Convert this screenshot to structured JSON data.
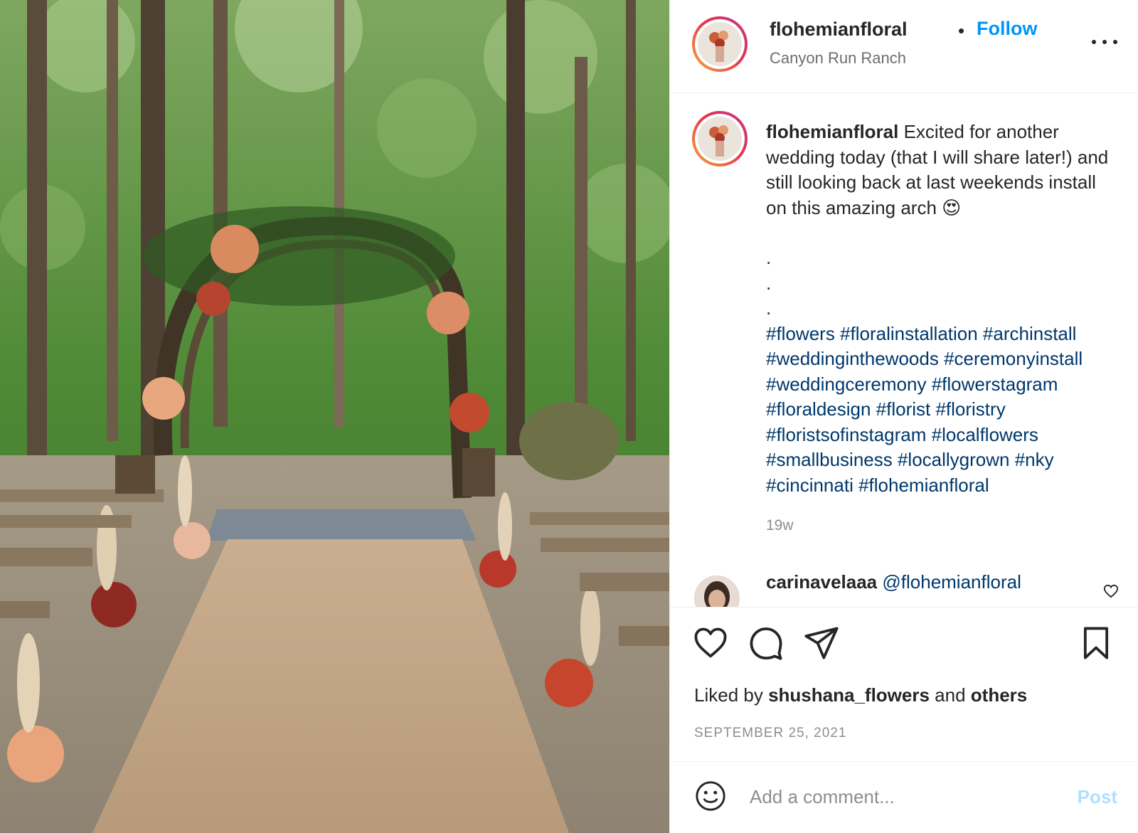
{
  "post": {
    "image_alt": "Woodland wedding ceremony with floral arch and burlap aisle",
    "header": {
      "username": "flohemianfloral",
      "separator": "•",
      "follow_label": "Follow",
      "location": "Canyon Run Ranch",
      "more_icon": "more-horizontal-icon"
    },
    "caption": {
      "username": "flohemianfloral",
      "text": "Excited for another wedding today (that I will share later!) and still looking back at last weekends install on this amazing arch",
      "emoji": "😍",
      "bullets": [
        ".",
        ".",
        "."
      ],
      "hashtags": "#flowers #floralinstallation #archinstall #weddinginthewoods #ceremonyinstall #weddingceremony #flowerstagram #floraldesign #florist #floristry #floristsofinstagram #localflowers #smallbusiness #locallygrown #nky #cincinnati #flohemianfloral",
      "age": "19w"
    },
    "comment": {
      "username": "carinavelaaa",
      "text": "@flohemianfloral"
    },
    "actions": {
      "like_icon": "heart-icon",
      "comment_icon": "comment-icon",
      "share_icon": "share-icon",
      "save_icon": "bookmark-icon"
    },
    "likes": {
      "prefix": "Liked by",
      "user": "shushana_flowers",
      "conj": "and",
      "others": "others"
    },
    "date": "SEPTEMBER 25, 2021",
    "add_comment": {
      "placeholder": "Add a comment...",
      "post_label": "Post"
    }
  },
  "colors": {
    "link_blue": "#0095f6",
    "hashtag_blue": "#00376b",
    "muted_gray": "#8e8e8e",
    "post_disabled": "#b2dffc"
  }
}
